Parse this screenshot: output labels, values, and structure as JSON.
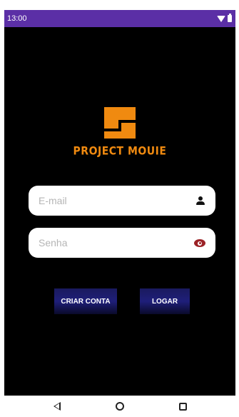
{
  "status_bar": {
    "time": "13:00"
  },
  "logo": {
    "text": "PROJECT MOUIE"
  },
  "form": {
    "email_placeholder": "E-mail",
    "password_placeholder": "Senha"
  },
  "buttons": {
    "create_account": "CRIAR CONTA",
    "login": "LOGAR"
  },
  "nav_bar": {
    "items": [
      "back",
      "home",
      "recent-apps"
    ]
  },
  "colors": {
    "status_bar": "#5b2fa6",
    "background": "#000000",
    "brand_orange": "#f08a10",
    "eye_icon": "#9b2226",
    "button_bg": "#1f1f7a"
  },
  "icons": [
    "wifi-icon",
    "battery-icon",
    "logo-icon",
    "user-icon",
    "eye-icon",
    "back-icon",
    "home-icon",
    "recent-apps-icon"
  ]
}
